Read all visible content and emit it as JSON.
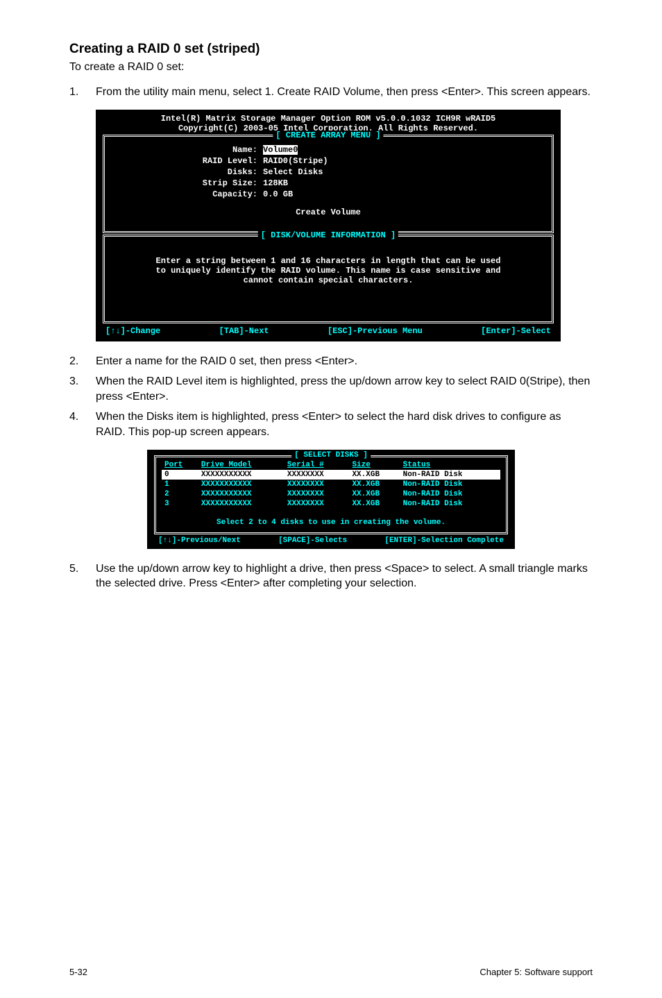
{
  "heading": "Creating a RAID 0 set (striped)",
  "intro": "To create a RAID 0 set:",
  "step1_num": "1.",
  "step1_text": "From the utility main menu, select 1. Create RAID Volume, then press <Enter>. This screen appears.",
  "t1": {
    "title1": "Intel(R) Matrix Storage Manager Option ROM v5.0.0.1032 ICH9R wRAID5",
    "title2": "Copyright(C) 2003-05 Intel Corporation. All Rights Reserved.",
    "box1_title": "[ CREATE ARRAY MENU ]",
    "k_name": "Name:",
    "v_name": "Volume0",
    "k_raid": "RAID Level:",
    "v_raid": "RAID0(Stripe)",
    "k_disks": "Disks:",
    "v_disks": "Select Disks",
    "k_strip": "Strip Size:",
    "v_strip": "128KB",
    "k_cap": "Capacity:",
    "v_cap": "0.0   GB",
    "create": "Create Volume",
    "box2_title": "[ DISK/VOLUME INFORMATION ]",
    "info1": "Enter a string between 1 and 16 characters in length that can be used",
    "info2": "to uniquely identify the RAID volume. This name is case sensitive and",
    "info3": "cannot contain special characters.",
    "h1": "[↑↓]-Change",
    "h2": "[TAB]-Next",
    "h3": "[ESC]-Previous Menu",
    "h4": "[Enter]-Select"
  },
  "step2_num": "2.",
  "step2_text": "Enter a name for the RAID 0 set, then press <Enter>.",
  "step3_num": "3.",
  "step3_text": "When the RAID Level item is highlighted, press the up/down arrow key to select RAID 0(Stripe), then press <Enter>.",
  "step4_num": "4.",
  "step4_text": "When the Disks item is highlighted, press <Enter> to select the hard disk drives to configure as RAID. This pop-up screen appears.",
  "t2": {
    "box_title": "[ SELECT DISKS ]",
    "h_port": "Port",
    "h_model": "Drive Model",
    "h_serial": "Serial #",
    "h_size": "Size",
    "h_status": "Status",
    "rows": [
      {
        "p": "0",
        "m": "XXXXXXXXXXX",
        "s": "XXXXXXXX",
        "z": "XX.XGB",
        "st": "Non-RAID Disk",
        "sel": true
      },
      {
        "p": "1",
        "m": "XXXXXXXXXXX",
        "s": "XXXXXXXX",
        "z": "XX.XGB",
        "st": "Non-RAID Disk",
        "sel": false
      },
      {
        "p": "2",
        "m": "XXXXXXXXXXX",
        "s": "XXXXXXXX",
        "z": "XX.XGB",
        "st": "Non-RAID Disk",
        "sel": false
      },
      {
        "p": "3",
        "m": "XXXXXXXXXXX",
        "s": "XXXXXXXX",
        "z": "XX.XGB",
        "st": "Non-RAID Disk",
        "sel": false
      }
    ],
    "hint": "Select 2 to 4 disks to use in creating the volume.",
    "f1": "[↑↓]-Previous/Next",
    "f2": "[SPACE]-Selects",
    "f3": "[ENTER]-Selection Complete"
  },
  "step5_num": "5.",
  "step5_text": "Use the up/down arrow key to highlight a drive, then press <Space>  to select. A small triangle marks the selected drive. Press <Enter> after completing your selection.",
  "footer_left": "5-32",
  "footer_right": "Chapter 5: Software support"
}
